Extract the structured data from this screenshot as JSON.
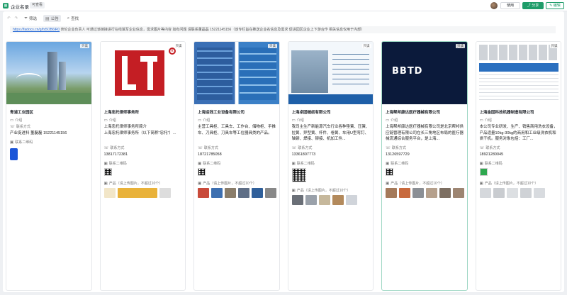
{
  "topbar": {
    "app_icon": "sheet-icon",
    "title": "企业名录",
    "permission": "可查看",
    "btn_use": "使用",
    "btn_share": "分享",
    "btn_edit": "编辑"
  },
  "toolbar": {
    "filter": "筛选",
    "notice": "公告",
    "search": "查找"
  },
  "notice": {
    "link": "https://fadocs.cn/g/fs5OB6lR0",
    "text": "   奈伦企业负责人 可通过该链接进行在线填写企业信息，需求图片等内容 如有问题 请联系董磊磊  15221145156（该专栏旨在推送企业名信息及需求 促进园区企业上下游合作 相关信息仅用于内部）"
  },
  "labels": {
    "intro": "介绍",
    "contact": "联系方式",
    "qr": "联系二维码",
    "products": "产品（请上传图片，不超过10个）",
    "readonly": "只读"
  },
  "cards": [
    {
      "name": "青浦工业园区",
      "intro": "",
      "contact": "产业促进科 董磊磊  15221145156",
      "qr": ""
    },
    {
      "name": "上海忠托律师事务所",
      "intro": "上海忠托律师事务所简介",
      "intro2": "上海忠托律师事务所（以下简称\"忠托\"）...",
      "contact": "13817172381"
    },
    {
      "name": "上海运钱工业设备有限公司",
      "intro": "主营工具柜、工具车、工作台、储物柜、手推车、刀具柜、刀具车等工位器具类的产品。",
      "contact": "18721785058"
    },
    {
      "name": "上海卓固缝纫有限公司",
      "intro": "我司主生产新能源汽车行业各种垫簧、压簧、拉簧、异型簧、杆件、卷簧、车用U型弯钉、轴铆、焊接、铆接、机加工件...",
      "contact": "13361807773"
    },
    {
      "name": "上海帮邦康达医疗器械有限公司",
      "intro": "上海帮邦康达医疗器械有限公司是北京帮邦供应链管理有限公司在长三角地区布局的医疗器械流通综合服务平台，是上海...",
      "contact": "13126597729"
    },
    {
      "name": "上海金固科技机器制造有限公司",
      "intro": "本公司专业研发、生产、销售商用洗衣设备，产品适量10kg-30kg的商用和工业级洗衣机和烘干机。服务对象包括：工厂...",
      "contact": "18921280045"
    }
  ],
  "colors": {
    "accent": "#1f9d6a",
    "link": "#2f6fd6"
  }
}
